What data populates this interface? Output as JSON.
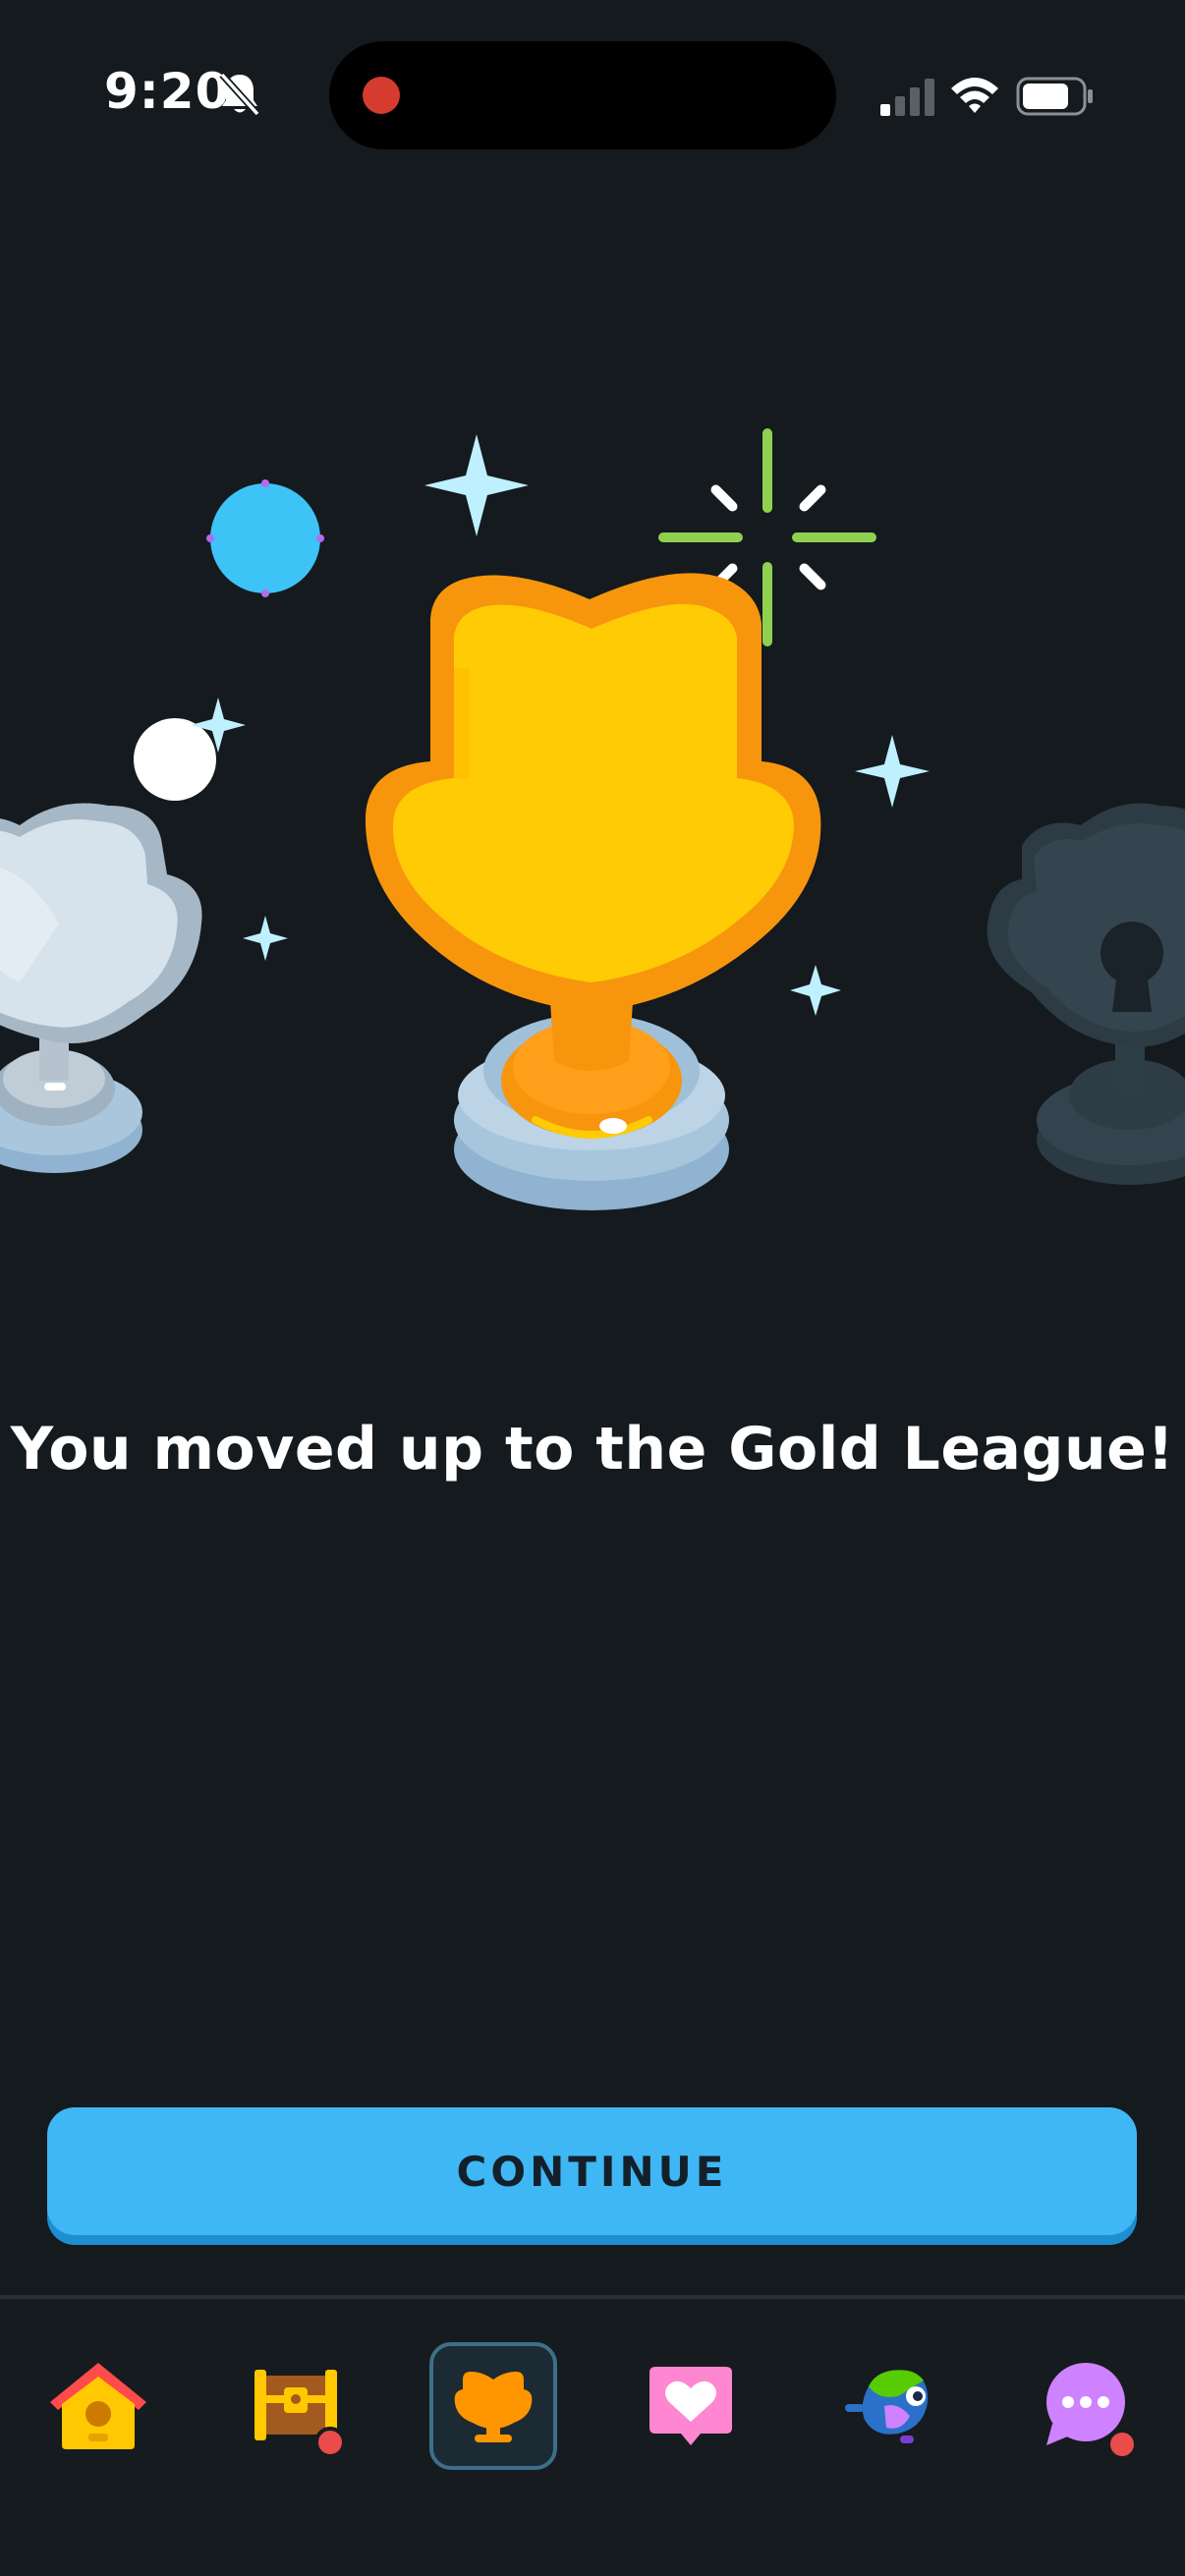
{
  "status_bar": {
    "time": "9:20",
    "silent_icon": "bell-slash-icon",
    "signal_icon": "cellular-signal-icon",
    "wifi_icon": "wifi-icon",
    "battery_icon": "battery-icon",
    "recording_icon": "recording-dot-icon"
  },
  "hero": {
    "center_trophy": "gold-trophy-icon",
    "left_trophy": "silver-trophy-icon",
    "right_trophy": "locked-trophy-icon"
  },
  "headline": "You moved up to the Gold League!",
  "continue_button": {
    "label": "CONTINUE"
  },
  "bottom_nav": {
    "items": [
      {
        "icon": "home-icon",
        "active": false,
        "badge": false
      },
      {
        "icon": "treasure-chest-icon",
        "active": false,
        "badge": true
      },
      {
        "icon": "trophy-icon",
        "active": true,
        "badge": false
      },
      {
        "icon": "heart-message-icon",
        "active": false,
        "badge": false
      },
      {
        "icon": "bird-avatar-icon",
        "active": false,
        "badge": false
      },
      {
        "icon": "more-icon",
        "active": false,
        "badge": true
      }
    ]
  },
  "colors": {
    "background": "#141a1e",
    "accent_blue": "#3fb7f4",
    "gold": "#ffcb05",
    "gold_rim": "#f7960d",
    "badge_red": "#ea4b4b"
  }
}
